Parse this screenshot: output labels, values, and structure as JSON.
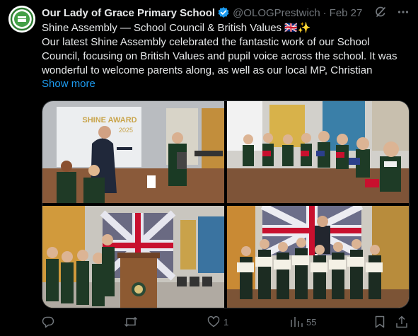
{
  "account": {
    "name": "Our Lady of Grace Primary School",
    "handle": "@OLOGPrestwich",
    "separator": "·",
    "date": "Feb 27"
  },
  "post": {
    "lines": [
      "Shine Assembly — School Council & British Values 🇬🇧✨",
      "Our latest Shine Assembly celebrated the fantastic work of our School",
      "Council, focusing on British Values and pupil voice across the school. It was",
      "wonderful to welcome parents along, as well as our local MP, Christian"
    ],
    "show_more": "Show more"
  },
  "media": {
    "photo1_banner": "SHINE AWARD",
    "photo1_year": "2025"
  },
  "actions": {
    "reply_count": "",
    "repost_count": "",
    "like_count": "1",
    "views_count": "55"
  },
  "colors": {
    "background": "#000000",
    "text": "#e7e9ea",
    "muted": "#71767b",
    "link": "#1d9bf0",
    "verified": "#1d9bf0"
  },
  "icons": [
    "school-logo-icon",
    "verified-badge-icon",
    "grok-icon",
    "more-icon",
    "reply-icon",
    "repost-icon",
    "like-icon",
    "views-icon",
    "bookmark-icon",
    "share-icon"
  ]
}
